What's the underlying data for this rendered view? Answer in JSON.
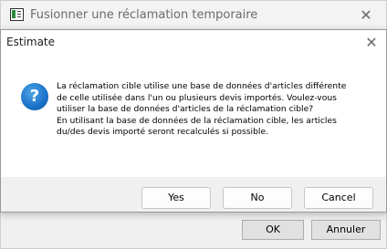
{
  "parent_window": {
    "title": "Fusionner une réclamation temporaire",
    "close_glyph": "✕",
    "ok_label": "OK",
    "cancel_label": "Annuler"
  },
  "dialog": {
    "title": "Estimate",
    "close_glyph": "✕",
    "icon": "question-icon",
    "icon_glyph": "?",
    "message_lines": [
      "La réclamation cible utilise une base de données d'articles différente",
      "de celle utilisée dans l'un ou plusieurs devis importés. Voulez-vous",
      "utiliser la base de données d'articles de la réclamation cible?",
      "En utilisant la base de données de la réclamation cible, les articles",
      "du/des devis importé  seront recalculés si possible."
    ],
    "buttons": {
      "yes": "Yes",
      "no": "No",
      "cancel": "Cancel"
    }
  }
}
